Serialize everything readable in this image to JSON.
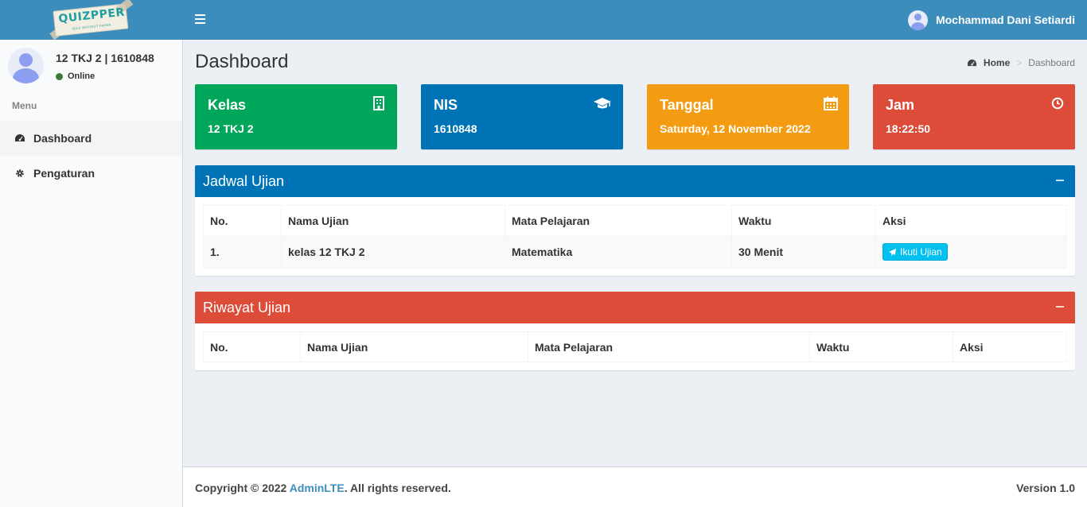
{
  "header": {
    "logo_text": "QUIZPPER",
    "logo_tagline": "QUIZ WITHOUT PAPER",
    "user_name": "Mochammad Dani Setiardi"
  },
  "sidebar": {
    "user_title": "12 TKJ 2 | 1610848",
    "status": "Online",
    "menu_header": "Menu",
    "items": [
      {
        "label": "Dashboard",
        "icon": "dashboard-icon"
      },
      {
        "label": "Pengaturan",
        "icon": "gear-icon"
      }
    ]
  },
  "page": {
    "title": "Dashboard",
    "breadcrumb": {
      "home": "Home",
      "current": "Dashboard"
    }
  },
  "info_boxes": [
    {
      "title": "Kelas",
      "value": "12 TKJ 2",
      "icon": "building-icon",
      "color": "#00a65a"
    },
    {
      "title": "NIS",
      "value": "1610848",
      "icon": "graduation-cap-icon",
      "color": "#0073b7"
    },
    {
      "title": "Tanggal",
      "value": "Saturday, 12 November 2022",
      "icon": "calendar-icon",
      "color": "#f39c12"
    },
    {
      "title": "Jam",
      "value": "18:22:50",
      "icon": "clock-icon",
      "color": "#dd4b39"
    }
  ],
  "jadwal": {
    "title": "Jadwal Ujian",
    "color": "#0073b7",
    "columns": [
      "No.",
      "Nama Ujian",
      "Mata Pelajaran",
      "Waktu",
      "Aksi"
    ],
    "rows": [
      {
        "no": "1.",
        "nama": "kelas 12 TKJ 2",
        "mapel": "Matematika",
        "waktu": "30 Menit",
        "aksi": "Ikuti Ujian"
      }
    ]
  },
  "riwayat": {
    "title": "Riwayat Ujian",
    "color": "#dd4b39",
    "columns": [
      "No.",
      "Nama Ujian",
      "Mata Pelajaran",
      "Waktu",
      "Aksi"
    ]
  },
  "footer": {
    "copyright_prefix": "Copyright © 2022 ",
    "copyright_link": "AdminLTE",
    "copyright_suffix": ". All rights reserved.",
    "version": "Version 1.0"
  }
}
